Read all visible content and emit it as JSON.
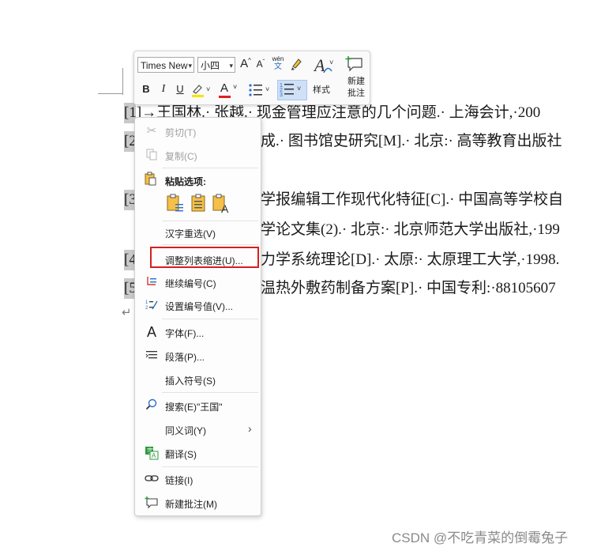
{
  "document": {
    "lines": [
      "[1]→王国林.· 张越.· 现金管理应注意的几个问题.· 上海会计,·200",
      "[2",
      "成.· 图书馆史研究[M].· 北京:· 高等教育出版社",
      "[3",
      "学报编辑工作现代化特征[C].· 中国高等学校自",
      "学论文集(2).· 北京:· 北京师范大学出版社,·199",
      "[4",
      "力学系统理论[D].· 太原:· 太原理工大学,·1998.",
      "[5",
      "温热外敷药制备方案[P].· 中国专利:·88105607"
    ],
    "pilcrow": "↵"
  },
  "toolbar": {
    "font_name": "Times New",
    "font_size": "小四",
    "grow_font": "A",
    "shrink_font": "A",
    "phonetic_top": "wén",
    "phonetic_bottom": "文",
    "bold": "B",
    "italic": "I",
    "underline": "U",
    "font_color_letter": "A",
    "styles_label": "样式",
    "new_comment_label_1": "新建",
    "new_comment_label_2": "批注"
  },
  "context_menu": {
    "cut": "剪切(T)",
    "copy": "复制(C)",
    "paste_options": "粘贴选项:",
    "hanzi_reselect": "汉字重选(V)",
    "adjust_list_indent": "调整列表缩进(U)...",
    "continue_numbering": "继续编号(C)",
    "set_numbering_value": "设置编号值(V)...",
    "font": "字体(F)...",
    "paragraph": "段落(P)...",
    "insert_symbol": "插入符号(S)",
    "search": "搜索(E)\"王国\"",
    "synonyms": "同义词(Y)",
    "translate": "翻译(S)",
    "link": "链接(I)",
    "new_comment": "新建批注(M)"
  },
  "colors": {
    "highlight_box": "#d61f1f",
    "font_color_bar": "#e31d1d",
    "highlighter_bar": "#f5e400",
    "accent_blue": "#2b6fc7"
  },
  "watermark": "CSDN @不吃青菜的倒霉兔子"
}
